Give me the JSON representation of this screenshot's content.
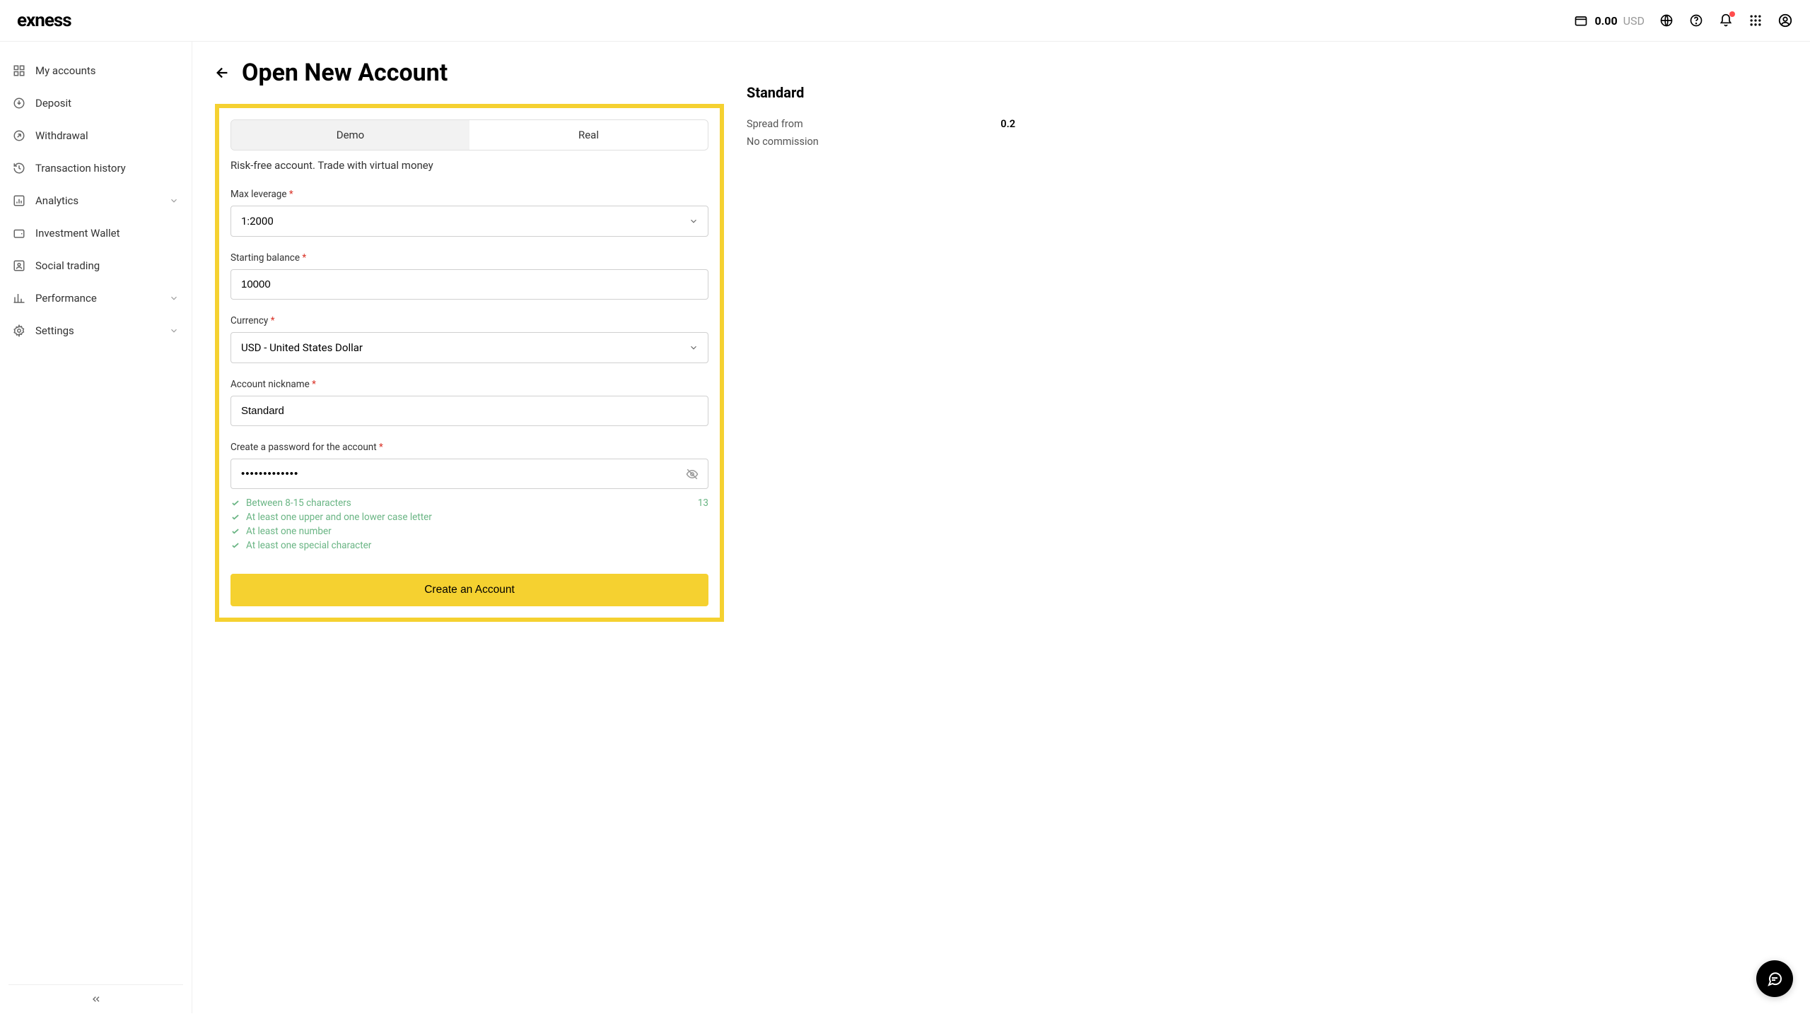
{
  "header": {
    "logo": "exness",
    "balance_amount": "0.00",
    "balance_currency": "USD"
  },
  "sidebar": {
    "items": [
      {
        "label": "My accounts",
        "icon": "grid",
        "expandable": false
      },
      {
        "label": "Deposit",
        "icon": "download-circle",
        "expandable": false
      },
      {
        "label": "Withdrawal",
        "icon": "arrow-up-right-circle",
        "expandable": false
      },
      {
        "label": "Transaction history",
        "icon": "history",
        "expandable": false
      },
      {
        "label": "Analytics",
        "icon": "analytics",
        "expandable": true
      },
      {
        "label": "Investment Wallet",
        "icon": "wallet",
        "expandable": false
      },
      {
        "label": "Social trading",
        "icon": "people",
        "expandable": false
      },
      {
        "label": "Performance",
        "icon": "bar-chart",
        "expandable": true
      },
      {
        "label": "Settings",
        "icon": "gear",
        "expandable": true
      }
    ]
  },
  "page": {
    "title": "Open New Account",
    "tabs": [
      {
        "label": "Demo",
        "active": true
      },
      {
        "label": "Real",
        "active": false
      }
    ],
    "tab_desc": "Risk-free account. Trade with virtual money",
    "fields": {
      "max_leverage": {
        "label": "Max leverage",
        "value": "1:2000"
      },
      "starting_balance": {
        "label": "Starting balance",
        "value": "10000"
      },
      "currency": {
        "label": "Currency",
        "value": "USD - United States Dollar"
      },
      "nickname": {
        "label": "Account nickname",
        "value": "Standard"
      },
      "password": {
        "label": "Create a password for the account",
        "value": "•••••••••••••"
      }
    },
    "password_rules": [
      "Between 8-15 characters",
      "At least one upper and one lower case letter",
      "At least one number",
      "At least one special character"
    ],
    "password_count": "13",
    "submit_label": "Create an Account"
  },
  "summary": {
    "title": "Standard",
    "rows": [
      {
        "label": "Spread from",
        "value": "0.2"
      },
      {
        "label": "No commission",
        "value": ""
      }
    ]
  }
}
